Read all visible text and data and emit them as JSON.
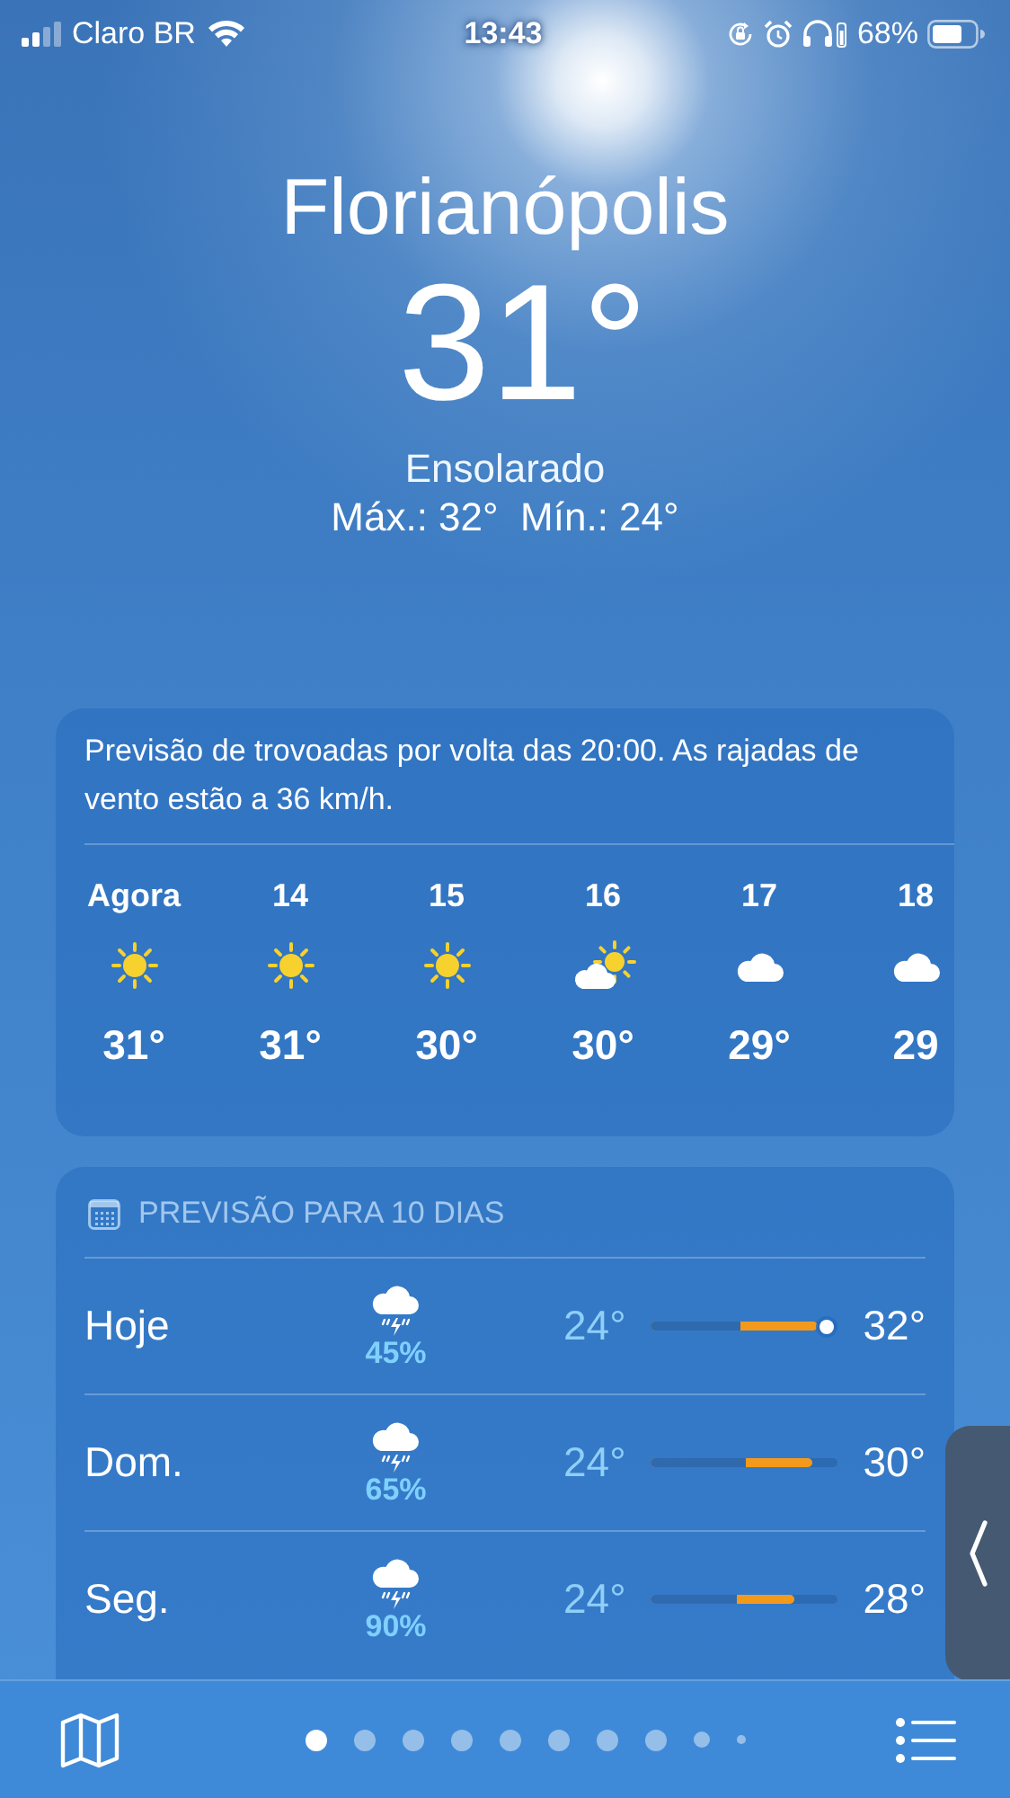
{
  "status_bar": {
    "carrier": "Claro BR",
    "time": "13:43",
    "battery": "68%"
  },
  "location": {
    "city": "Florianópolis",
    "temperature": "31°",
    "condition": "Ensolarado",
    "high_low": "Máx.: 32°  Mín.: 24°"
  },
  "hourly": {
    "summary": "Previsão de trovoadas por volta das 20:00. As rajadas de vento estão a 36 km/h.",
    "hours": [
      {
        "time": "Agora",
        "kind": "sun",
        "temp": "31°"
      },
      {
        "time": "14",
        "kind": "sun",
        "temp": "31°"
      },
      {
        "time": "15",
        "kind": "sun",
        "temp": "30°"
      },
      {
        "time": "16",
        "kind": "partly-cloudy",
        "temp": "30°"
      },
      {
        "time": "17",
        "kind": "cloud",
        "temp": "29°"
      },
      {
        "time": "18",
        "kind": "cloud",
        "temp": "29"
      }
    ]
  },
  "ten_day": {
    "title": "PREVISÃO PARA 10 DIAS",
    "days": [
      {
        "day": "Hoje",
        "kind": "thunder-rain",
        "chance": "45%",
        "low": "24°",
        "high": "32°",
        "range_start": {
          "level": 0.48
        },
        "range_end": {
          "level": 0.89
        },
        "now_marker": {
          "level": 0.94
        }
      },
      {
        "day": "Dom.",
        "kind": "thunder-rain",
        "chance": "65%",
        "low": "24°",
        "high": "30°",
        "range_start": {
          "level": 0.51
        },
        "range_end": {
          "level": 0.86
        }
      },
      {
        "day": "Seg.",
        "kind": "thunder-rain",
        "chance": "90%",
        "low": "24°",
        "high": "28°",
        "range_start": {
          "level": 0.46
        },
        "range_end": {
          "level": 0.77
        }
      }
    ]
  },
  "page_dots": [
    {
      "selected": true,
      "kind": "full"
    },
    {
      "selected": false,
      "kind": "full"
    },
    {
      "selected": false,
      "kind": "full"
    },
    {
      "selected": false,
      "kind": "full"
    },
    {
      "selected": false,
      "kind": "full"
    },
    {
      "selected": false,
      "kind": "full"
    },
    {
      "selected": false,
      "kind": "full"
    },
    {
      "selected": false,
      "kind": "full"
    },
    {
      "selected": false,
      "kind": "small"
    },
    {
      "selected": false,
      "kind": "tiny"
    }
  ]
}
